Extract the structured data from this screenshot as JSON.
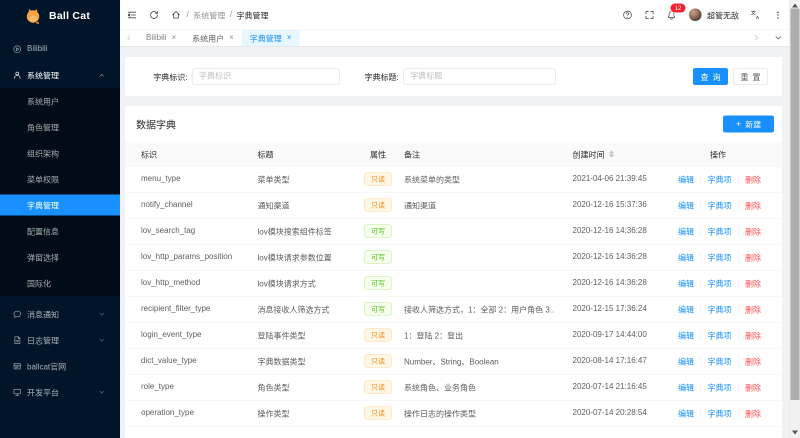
{
  "app": {
    "logo_text": "Ball Cat",
    "accent_color": "#1890ff",
    "sidebar_color": "#001529"
  },
  "sidebar": {
    "items": {
      "bilibili": {
        "label": "Bilibili",
        "icon": "play-circle"
      },
      "system": {
        "label": "系统管理",
        "icon": "user",
        "expanded": true
      },
      "children": [
        {
          "label": "系统用户"
        },
        {
          "label": "角色管理"
        },
        {
          "label": "组织架构"
        },
        {
          "label": "菜单权限"
        },
        {
          "label": "字典管理",
          "selected": true
        },
        {
          "label": "配置信息"
        },
        {
          "label": "弹窗选择"
        },
        {
          "label": "国际化"
        }
      ],
      "message": {
        "label": "消息通知",
        "icon": "message",
        "collapsed": true
      },
      "log": {
        "label": "日志管理",
        "icon": "file",
        "collapsed": true
      },
      "site": {
        "label": "ballcat官网",
        "icon": "site"
      },
      "dev": {
        "label": "开发平台",
        "icon": "desktop",
        "collapsed": true
      }
    }
  },
  "header": {
    "breadcrumb": {
      "sep": "/",
      "parent": "系统管理",
      "current": "字典管理"
    },
    "notice_count": "12",
    "username": "超管无敌"
  },
  "tabs": {
    "items": [
      {
        "label": "Bilibili",
        "close": "×"
      },
      {
        "label": "系统用户",
        "close": "×"
      },
      {
        "label": "字典管理",
        "close": "×",
        "active": true
      }
    ]
  },
  "search": {
    "code_label": "字典标识:",
    "code_placeholder": "字典标识",
    "title_label": "字典标题:",
    "title_placeholder": "字典标题",
    "query_label": "查询",
    "reset_label": "重置"
  },
  "table": {
    "card_title": "数据字典",
    "new_label": "新建",
    "plus": "+",
    "columns": [
      "标识",
      "标题",
      "属性",
      "备注",
      "创建时间",
      "操作"
    ],
    "row_actions": [
      "编辑",
      "字典项",
      "删除"
    ],
    "rows": [
      {
        "code": "menu_type",
        "title": "菜单类型",
        "attr": {
          "label": "只读",
          "color": "orange"
        },
        "remark": "系统菜单的类型",
        "created": "2021-04-06 21:39:45"
      },
      {
        "code": "notify_channel",
        "title": "通知渠道",
        "attr": {
          "label": "只读",
          "color": "orange"
        },
        "remark": "通知渠道",
        "created": "2020-12-16 15:37:36"
      },
      {
        "code": "lov_search_tag",
        "title": "lov模块搜索组件标签",
        "attr": {
          "label": "可写",
          "color": "green"
        },
        "remark": "",
        "created": "2020-12-16 14:36:28"
      },
      {
        "code": "lov_http_params_position",
        "title": "lov模块请求参数位置",
        "attr": {
          "label": "可写",
          "color": "green"
        },
        "remark": "",
        "created": "2020-12-16 14:36:28"
      },
      {
        "code": "lov_http_method",
        "title": "lov模块请求方式",
        "attr": {
          "label": "可写",
          "color": "green"
        },
        "remark": "",
        "created": "2020-12-16 14:36:28"
      },
      {
        "code": "recipient_filter_type",
        "title": "消息接收人筛选方式",
        "attr": {
          "label": "可写",
          "color": "green"
        },
        "remark": "接收人筛选方式，1：全部 2：用户角色 3...",
        "created": "2020-12-15 17:36:24"
      },
      {
        "code": "login_event_type",
        "title": "登陆事件类型",
        "attr": {
          "label": "只读",
          "color": "orange"
        },
        "remark": "1：登陆 2：登出",
        "created": "2020-09-17 14:44:00"
      },
      {
        "code": "dict_value_type",
        "title": "字典数据类型",
        "attr": {
          "label": "只读",
          "color": "orange"
        },
        "remark": "Number、String、Boolean",
        "created": "2020-08-14 17:16:47"
      },
      {
        "code": "role_type",
        "title": "角色类型",
        "attr": {
          "label": "只读",
          "color": "orange"
        },
        "remark": "系统角色、业务角色",
        "created": "2020-07-14 21:16:45"
      },
      {
        "code": "operation_type",
        "title": "操作类型",
        "attr": {
          "label": "只读",
          "color": "orange"
        },
        "remark": "操作日志的操作类型",
        "created": "2020-07-14 20:28:54"
      }
    ]
  }
}
